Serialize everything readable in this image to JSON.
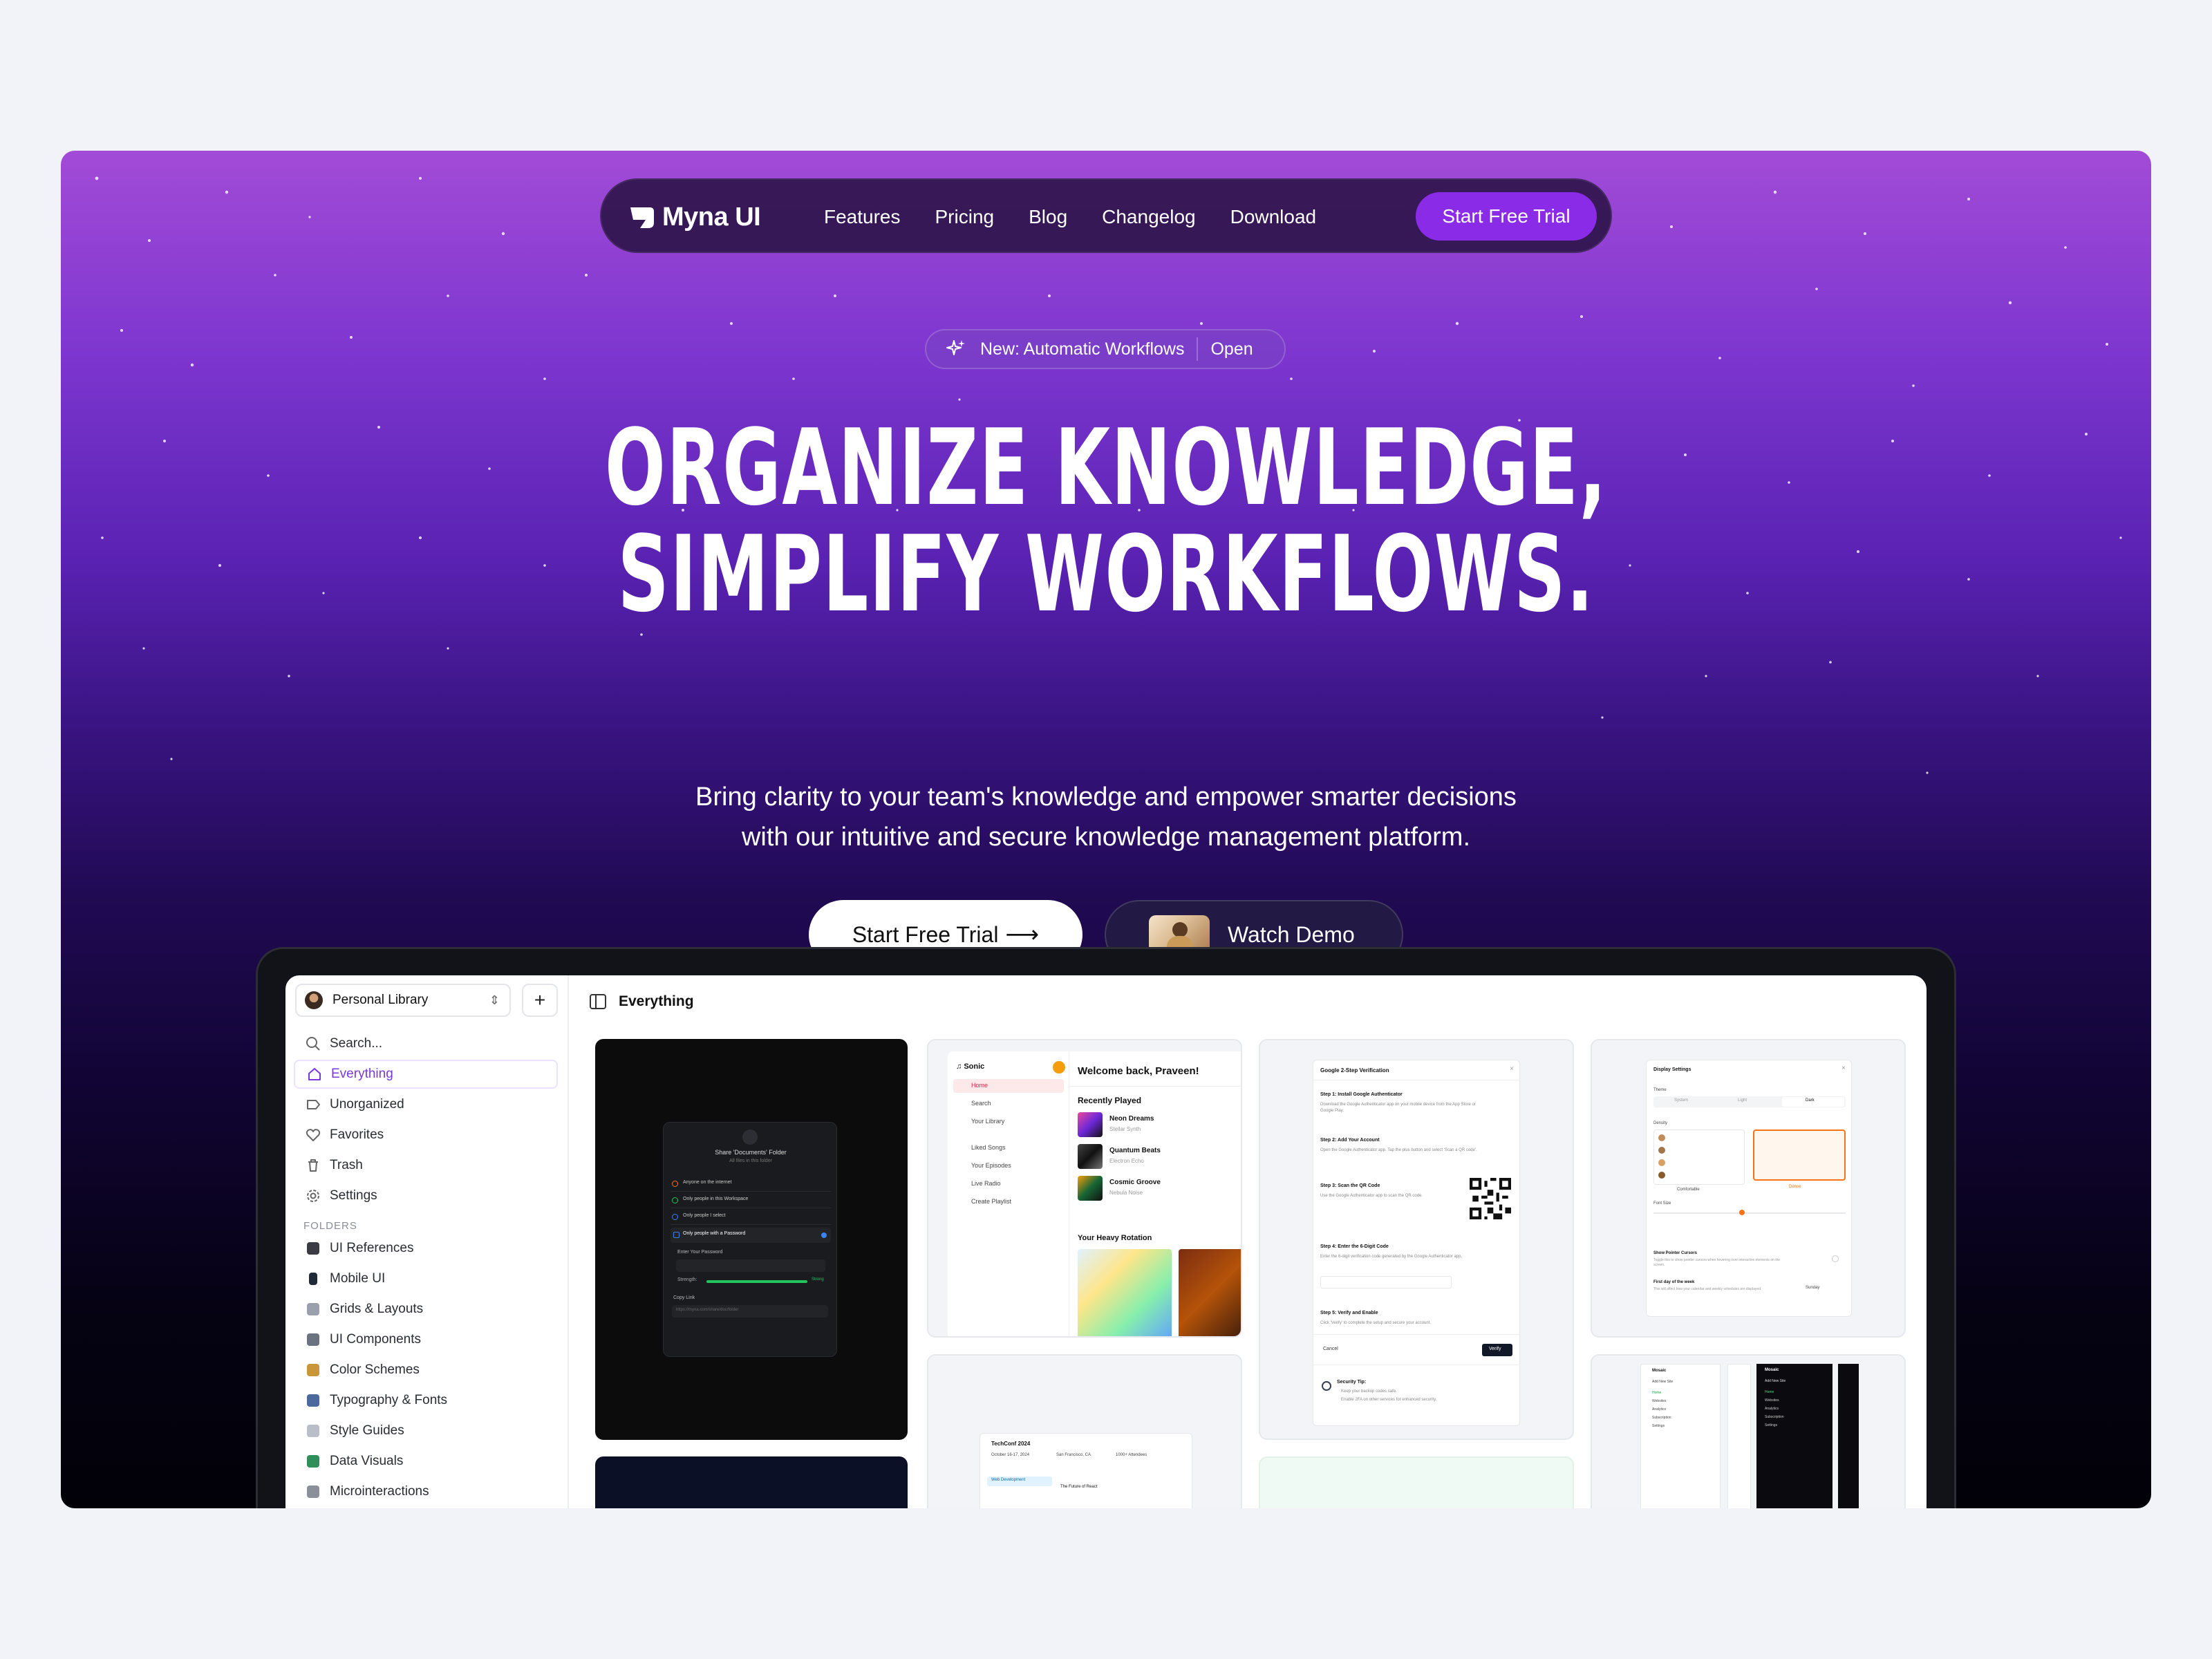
{
  "brand": {
    "name": "Myna UI"
  },
  "nav": {
    "links": [
      "Features",
      "Pricing",
      "Blog",
      "Changelog",
      "Download"
    ],
    "cta": "Start Free Trial"
  },
  "badge": {
    "label": "New: Automatic Workflows",
    "action": "Open"
  },
  "hero": {
    "headline_line1": "ORGANIZE KNOWLEDGE,",
    "headline_line2": "SIMPLIFY WORKFLOWS.",
    "subhead_line1": "Bring clarity to your team's knowledge and empower smarter decisions",
    "subhead_line2": "with our intuitive and secure knowledge management platform.",
    "primary_cta": "Start Free Trial",
    "secondary_cta": "Watch Demo"
  },
  "app": {
    "library": "Personal Library",
    "search_placeholder": "Search...",
    "nav": [
      {
        "label": "Everything",
        "icon": "home-icon",
        "active": true
      },
      {
        "label": "Unorganized",
        "icon": "tag-icon"
      },
      {
        "label": "Favorites",
        "icon": "heart-icon"
      },
      {
        "label": "Trash",
        "icon": "trash-icon"
      },
      {
        "label": "Settings",
        "icon": "gear-icon"
      }
    ],
    "folders_label": "FOLDERS",
    "folders": [
      {
        "label": "UI References",
        "color": "#3b3b44"
      },
      {
        "label": "Mobile UI",
        "color": "#1f2937"
      },
      {
        "label": "Grids & Layouts",
        "color": "#9aa1ad"
      },
      {
        "label": "UI Components",
        "color": "#6b7280"
      },
      {
        "label": "Color Schemes",
        "color": "#c9973a"
      },
      {
        "label": "Typography & Fonts",
        "color": "#4b6a9b"
      },
      {
        "label": "Style Guides",
        "color": "#b9bec8"
      },
      {
        "label": "Data Visuals",
        "color": "#2f8f5a"
      },
      {
        "label": "Microinteractions",
        "color": "#8a8f99"
      }
    ],
    "main_title": "Everything",
    "card_share": {
      "title": "Share 'Documents' Folder",
      "subtitle": "All files in this folder",
      "options": [
        "Anyone on the internet",
        "Only people in this Workspace",
        "Only people I select",
        "Only people with a Password"
      ],
      "password_label": "Enter Your Password",
      "strength_label": "Strength:",
      "strength_value": "Strong",
      "copy_label": "Copy Link",
      "link": "https://myna.com/share/doc/folder"
    },
    "card_music": {
      "app": "Sonic",
      "menu": [
        "Home",
        "Search",
        "Your Library",
        "Liked Songs",
        "Your Episodes",
        "Live Radio",
        "Create Playlist"
      ],
      "welcome": "Welcome back, Praveen!",
      "recent_label": "Recently Played",
      "tracks": [
        {
          "title": "Neon Dreams",
          "artist": "Stellar Synth"
        },
        {
          "title": "Quantum Beats",
          "artist": "Electron Echo"
        },
        {
          "title": "Cosmic Groove",
          "artist": "Nebula Noise"
        }
      ],
      "rotation_label": "Your Heavy Rotation"
    },
    "card_2fa": {
      "title": "Google 2-Step Verification",
      "steps": [
        {
          "title": "Step 1: Install Google Authenticator",
          "text": "Download the Google Authenticator app on your mobile device from the App Store or Google Play."
        },
        {
          "title": "Step 2: Add Your Account",
          "text": "Open the Google Authenticator app. Tap the plus button and select 'Scan a QR code'."
        },
        {
          "title": "Step 3: Scan the QR Code",
          "text": "Use the Google Authenticator app to scan the QR code."
        },
        {
          "title": "Step 4: Enter the 6-Digit Code",
          "text": "Enter the 6-digit verification code generated by the Google Authenticator app."
        },
        {
          "title": "Step 5: Verify and Enable",
          "text": "Click 'Verify' to complete the setup and secure your account."
        }
      ],
      "cancel": "Cancel",
      "verify": "Verify",
      "tip_title": "Security Tip:",
      "tips": [
        "Keep your backup codes safe.",
        "Enable 2FA on other services for enhanced security."
      ]
    },
    "card_display": {
      "title": "Display Settings",
      "theme_label": "Theme",
      "themes": [
        "System",
        "Light",
        "Dark"
      ],
      "density_label": "Density",
      "densities": [
        "Comfortable",
        "Dense"
      ],
      "font_size_label": "Font Size",
      "pointer_label": "Show Pointer Cursors",
      "pointer_text": "Toggle this to show pointer cursors when hovering over interactive elements on the screen.",
      "week_label": "First day of the week",
      "week_text": "This will affect how your calendar and weekly schedules are displayed.",
      "week_value": "Sunday"
    },
    "card_event": {
      "title": "TechConf 2024",
      "date": "October 16-17, 2024",
      "location": "San Francisco, CA",
      "attendees": "1000+ Attendees",
      "track": "Web Development",
      "talk": "The Future of React"
    },
    "card_mosaic": {
      "app": "Mosaic",
      "add": "Add New Site",
      "menu": [
        "Home",
        "Websites",
        "Analytics",
        "Subscription",
        "Settings"
      ]
    }
  }
}
